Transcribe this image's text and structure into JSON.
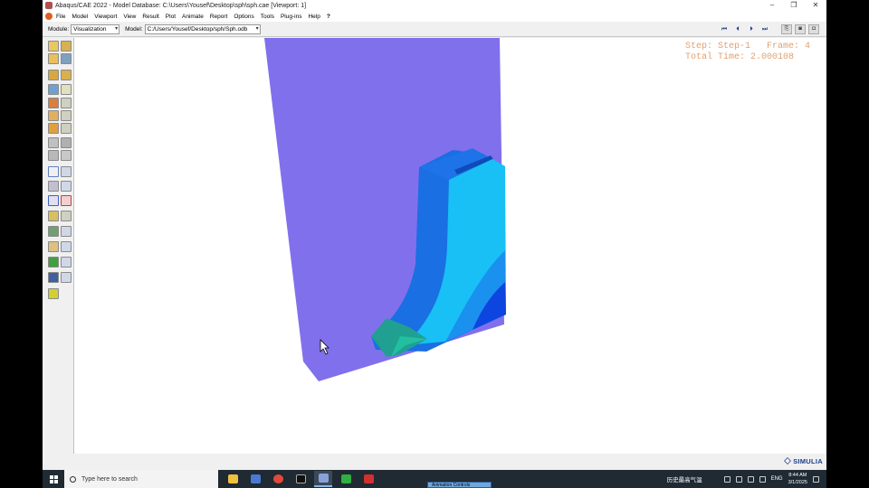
{
  "window": {
    "title": "Abaqus/CAE 2022 - Model Database: C:\\Users\\Yousef\\Desktop\\sph\\sph.cae [Viewport: 1]",
    "controls": [
      "–",
      "❐",
      "✕"
    ]
  },
  "menu": {
    "items": [
      "File",
      "Model",
      "Viewport",
      "View",
      "Result",
      "Plot",
      "Animate",
      "Report",
      "Options",
      "Tools",
      "Plug-ins",
      "Help",
      "?"
    ]
  },
  "context": {
    "module_label": "Module:",
    "module_value": "Visualization",
    "model_label": "Model:",
    "model_value": "C:/Users/Yousef/Desktop/sph/Sph.odb"
  },
  "animation_controls": {
    "buttons": [
      "first-frame",
      "previous-frame",
      "next-frame",
      "last-frame"
    ]
  },
  "viewport": {
    "step_line": "Step: Step-1   Frame: 4",
    "time_line": "Total Time: 2.000108",
    "colors": {
      "background_plate": "#8170ec",
      "inner_dark": "#1a6fe3",
      "inner_cyan": "#18c0f6",
      "inner_blue": "#0d45e0",
      "inner_green": "#20c0a0"
    }
  },
  "branding": {
    "logo_text": "SIMULIA"
  },
  "taskbar": {
    "search_placeholder": "Type here to search",
    "weather_text": "历史最高气温",
    "language": "ENG",
    "time": "8:44 AM",
    "date": "3/1/2025",
    "tooltip": "Animation Controls"
  }
}
